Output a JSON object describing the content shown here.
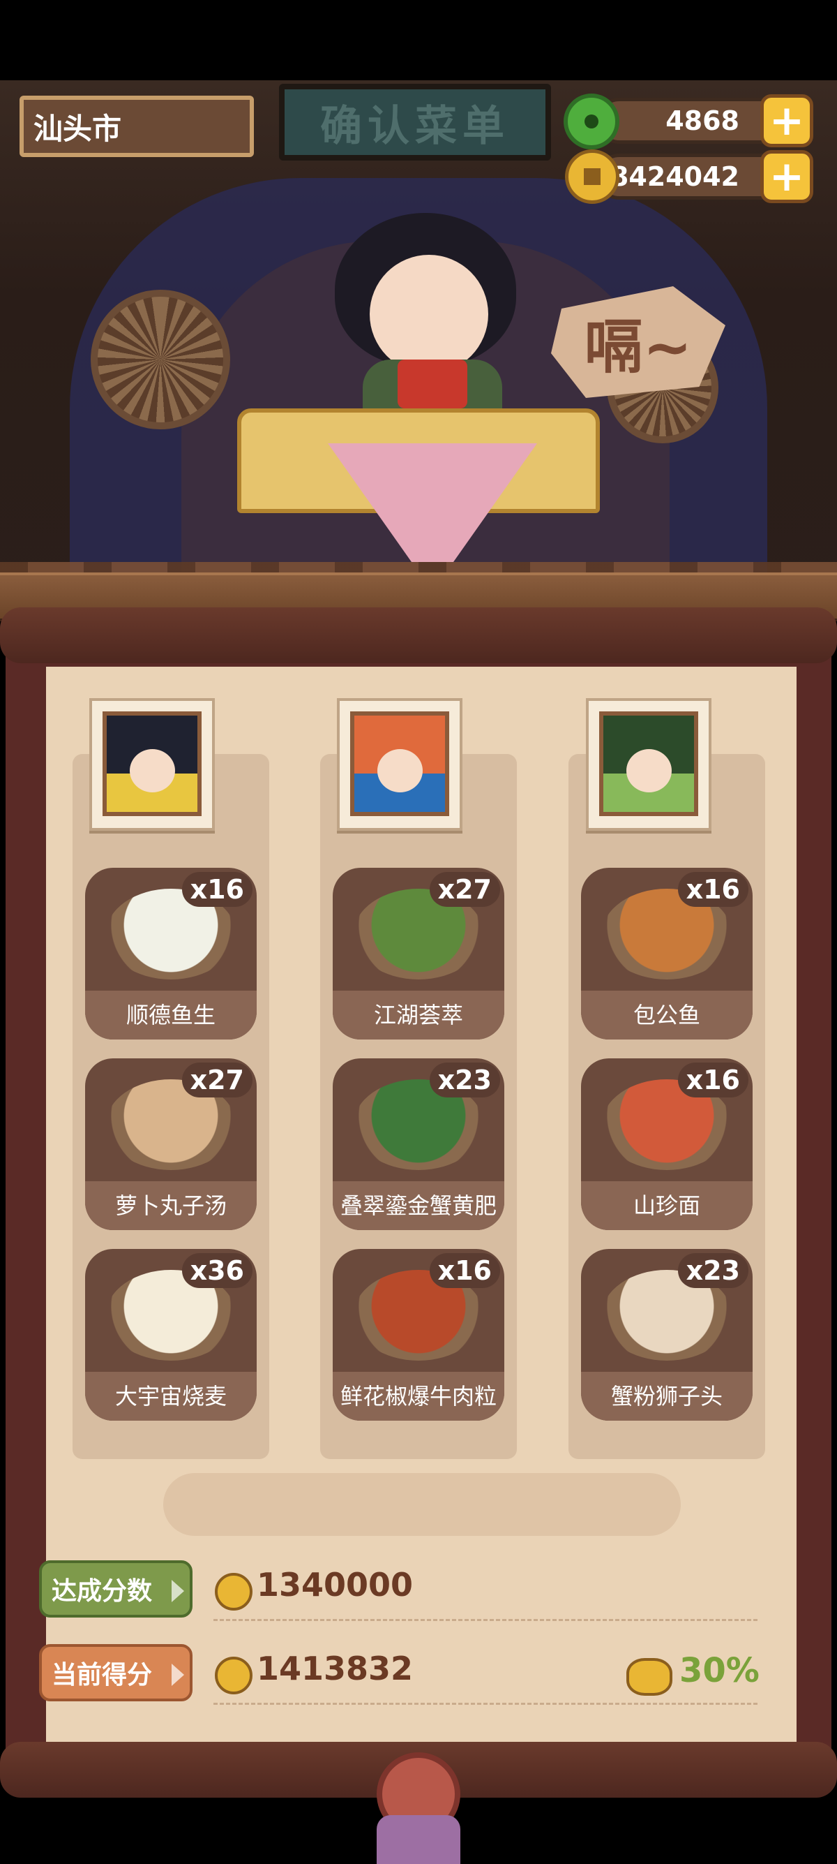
{
  "header": {
    "city": "汕头市",
    "sign_text": "确认菜单",
    "speech_bubble": "嗝~",
    "jade_amount": "4868",
    "coin_amount": "8424042",
    "plus_label": "+"
  },
  "columns": [
    {
      "portrait_colors": {
        "hair": "#1f2230",
        "bg": "#e8c640"
      },
      "dishes": [
        {
          "name": "顺德鱼生",
          "count": "x16",
          "color": "#f1f1e6"
        },
        {
          "name": "萝卜丸子汤",
          "count": "x27",
          "color": "#d9b48c"
        },
        {
          "name": "大宇宙烧麦",
          "count": "x36",
          "color": "#f4ecd9"
        }
      ]
    },
    {
      "portrait_colors": {
        "hair": "#e06a3c",
        "bg": "#2a6fb8"
      },
      "dishes": [
        {
          "name": "江湖荟萃",
          "count": "x27",
          "color": "#5e8a3c"
        },
        {
          "name": "叠翠鎏金蟹黄肥",
          "count": "x23",
          "color": "#3f7a3a"
        },
        {
          "name": "鲜花椒爆牛肉粒",
          "count": "x16",
          "color": "#b84a2a"
        }
      ]
    },
    {
      "portrait_colors": {
        "hair": "#2c4b2a",
        "bg": "#88b95a"
      },
      "dishes": [
        {
          "name": "包公鱼",
          "count": "x16",
          "color": "#c97a3a"
        },
        {
          "name": "山珍面",
          "count": "x16",
          "color": "#d25a3a"
        },
        {
          "name": "蟹粉狮子头",
          "count": "x23",
          "color": "#e9d7c0"
        }
      ]
    }
  ],
  "score": {
    "target_label": "达成分数",
    "target_value": "1340000",
    "current_label": "当前得分",
    "current_value": "1413832",
    "bonus_percent": "30%"
  }
}
